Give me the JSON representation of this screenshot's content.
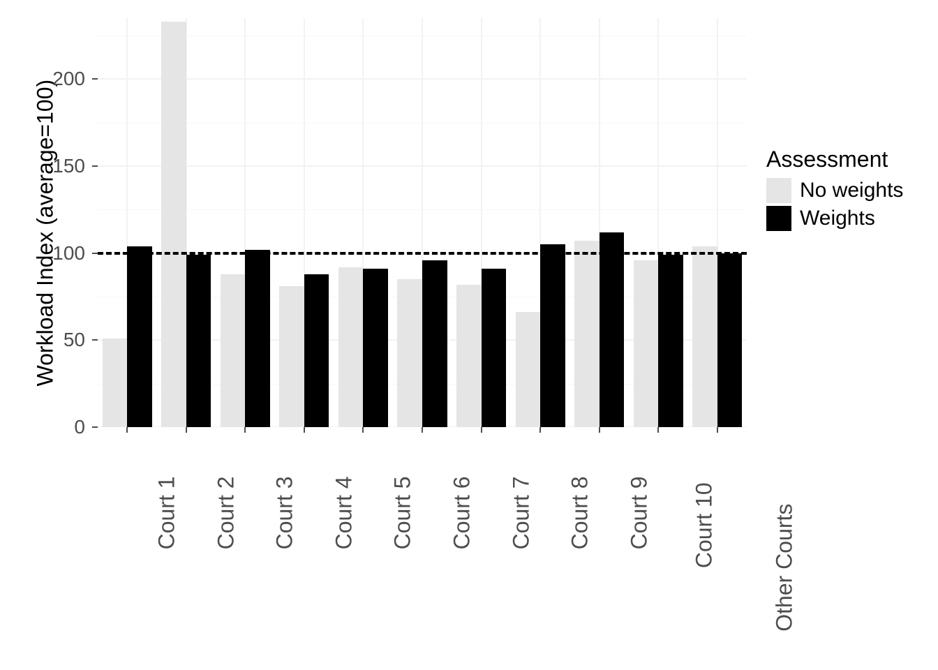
{
  "chart_data": {
    "type": "bar",
    "ylabel": "Workload Index (average=100)",
    "xlabel": "",
    "ylim": [
      0,
      235
    ],
    "ref_line": 100,
    "y_ticks": [
      0,
      50,
      100,
      150,
      200
    ],
    "categories": [
      "Court 1",
      "Court 2",
      "Court 3",
      "Court 4",
      "Court 5",
      "Court 6",
      "Court 7",
      "Court 8",
      "Court 9",
      "Court 10",
      "Other Courts"
    ],
    "series": [
      {
        "name": "No weights",
        "values": [
          51,
          233,
          88,
          81,
          92,
          85,
          82,
          66,
          107,
          96,
          104
        ]
      },
      {
        "name": "Weights",
        "values": [
          104,
          99,
          102,
          88,
          91,
          96,
          91,
          105,
          112,
          99,
          100
        ]
      }
    ],
    "legend_title": "Assessment",
    "colors": {
      "No weights": "#e5e5e5",
      "Weights": "#000000"
    }
  }
}
